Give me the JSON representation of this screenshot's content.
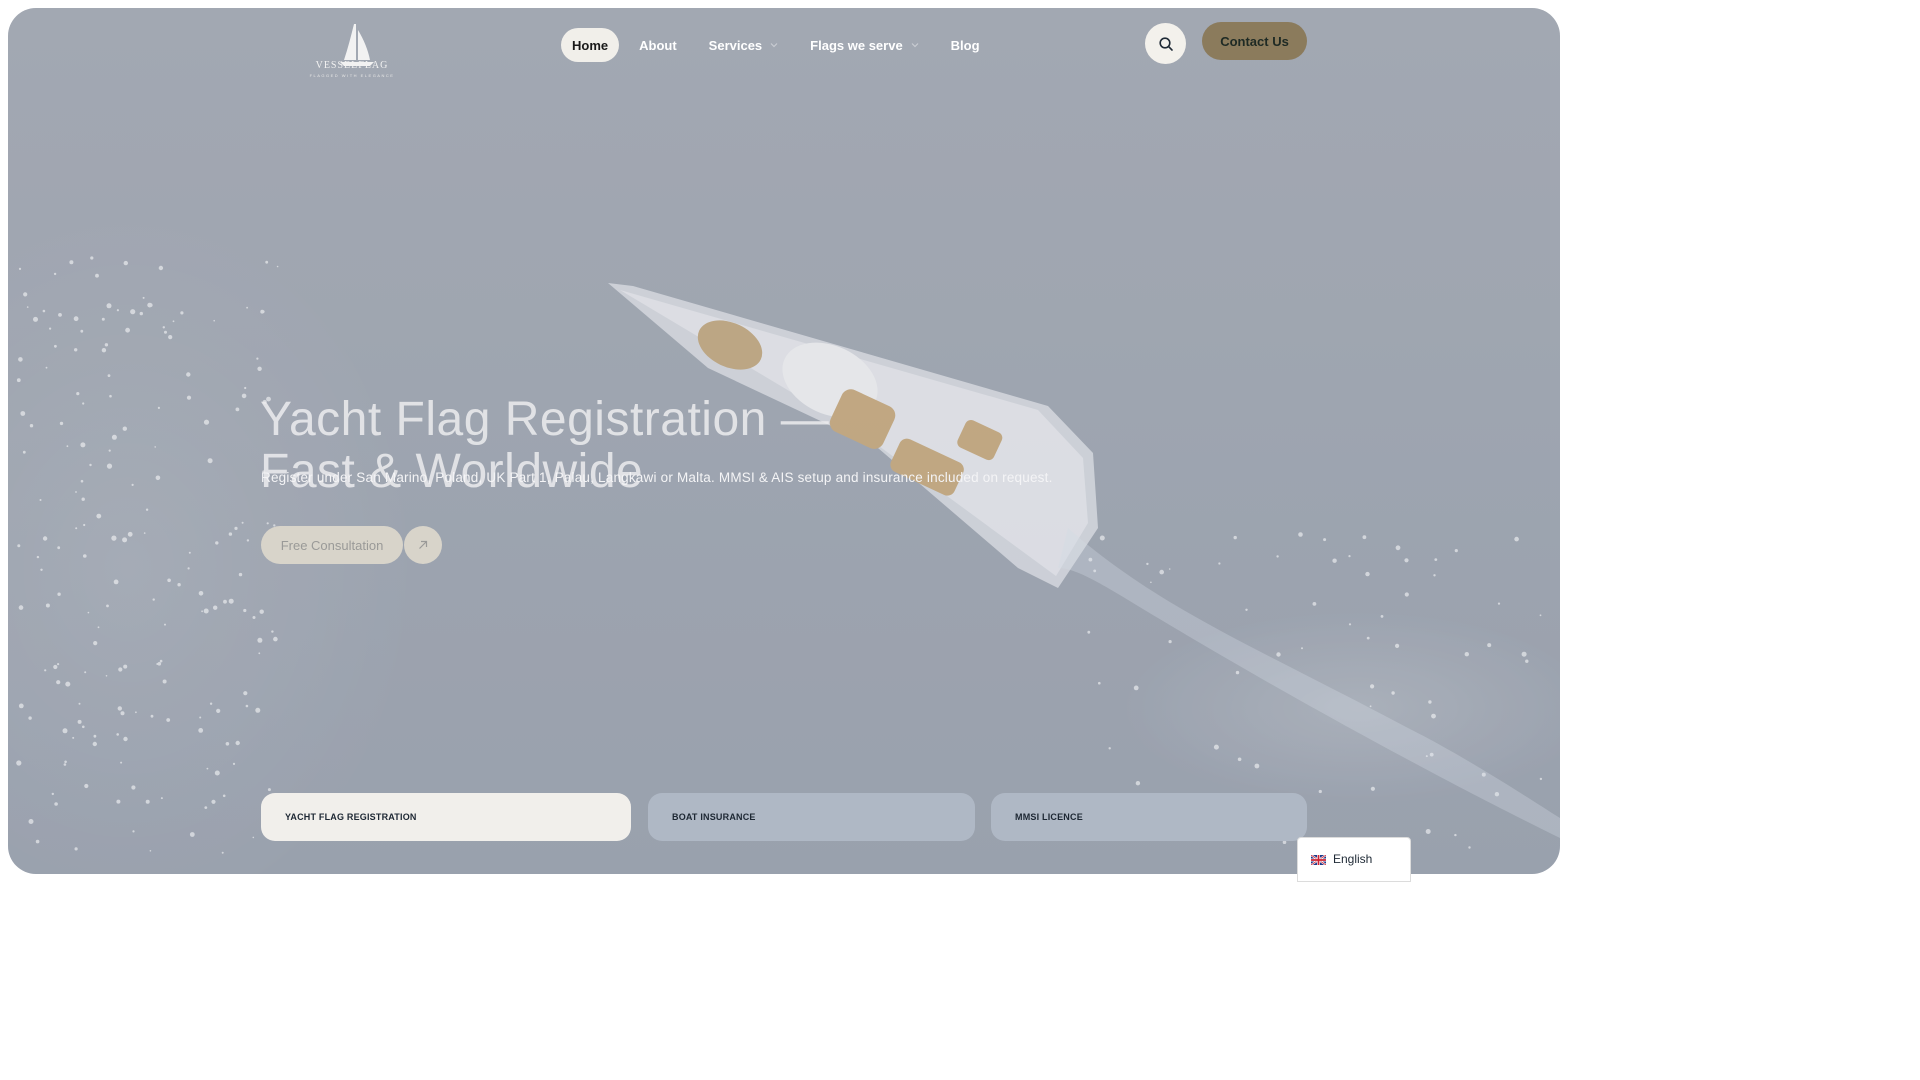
{
  "header": {
    "logo": {
      "name": "VESSELFLAG",
      "tagline": "FLAGGED WITH ELEGANCE",
      "icon": "sailboat-icon"
    },
    "nav": [
      {
        "label": "Home",
        "active": true,
        "dropdown": false
      },
      {
        "label": "About",
        "active": false,
        "dropdown": false
      },
      {
        "label": "Services",
        "active": false,
        "dropdown": true
      },
      {
        "label": "Flags we serve",
        "active": false,
        "dropdown": true
      },
      {
        "label": "Blog",
        "active": false,
        "dropdown": false
      }
    ],
    "search_icon": "search-icon",
    "contact_label": "Contact Us"
  },
  "hero": {
    "title_line1": "Yacht Flag Registration —",
    "title_line2": "Fast & Worldwide",
    "subtitle": "Register under San Marino, Poland, UK Part 1, Palau, Langkawi or Malta. MMSI & AIS setup and insurance included on request.",
    "cta_label": "Free Consultation",
    "cta_icon": "arrow-up-right-icon"
  },
  "service_tabs": [
    {
      "label": "YACHT FLAG REGISTRATION",
      "active": true
    },
    {
      "label": "BOAT INSURANCE",
      "active": false
    },
    {
      "label": "MMSI LICENCE",
      "active": false
    }
  ],
  "language": {
    "label": "English",
    "flag_icon": "uk-flag-icon"
  },
  "colors": {
    "accent": "#8b7b5c",
    "hero_overlay": "#a3a9b2",
    "tab_active": "#f1efeb",
    "tab_inactive": "#afb8c5",
    "nav_active": "#f1efea"
  }
}
